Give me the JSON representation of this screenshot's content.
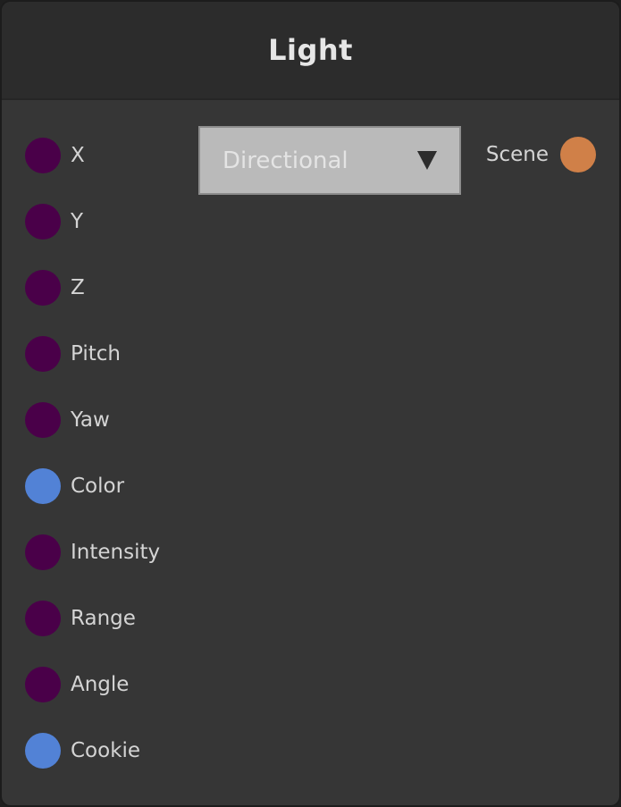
{
  "node": {
    "title": "Light",
    "inputs": [
      {
        "label": "X",
        "icon": "port-circle-icon",
        "color": "#4a0049"
      },
      {
        "label": "Y",
        "icon": "port-circle-icon",
        "color": "#4a0049"
      },
      {
        "label": "Z",
        "icon": "port-circle-icon",
        "color": "#4a0049"
      },
      {
        "label": "Pitch",
        "icon": "port-circle-icon",
        "color": "#4a0049"
      },
      {
        "label": "Yaw",
        "icon": "port-circle-icon",
        "color": "#4a0049"
      },
      {
        "label": "Color",
        "icon": "port-circle-icon",
        "color": "#5282d6"
      },
      {
        "label": "Intensity",
        "icon": "port-circle-icon",
        "color": "#4a0049"
      },
      {
        "label": "Range",
        "icon": "port-circle-icon",
        "color": "#4a0049"
      },
      {
        "label": "Angle",
        "icon": "port-circle-icon",
        "color": "#4a0049"
      },
      {
        "label": "Cookie",
        "icon": "port-circle-icon",
        "color": "#5282d6"
      }
    ],
    "output": {
      "label": "Scene",
      "icon": "port-circle-icon",
      "color": "#d08048"
    },
    "type_select": {
      "value": "Directional",
      "icon": "dropdown-arrow-icon"
    }
  }
}
